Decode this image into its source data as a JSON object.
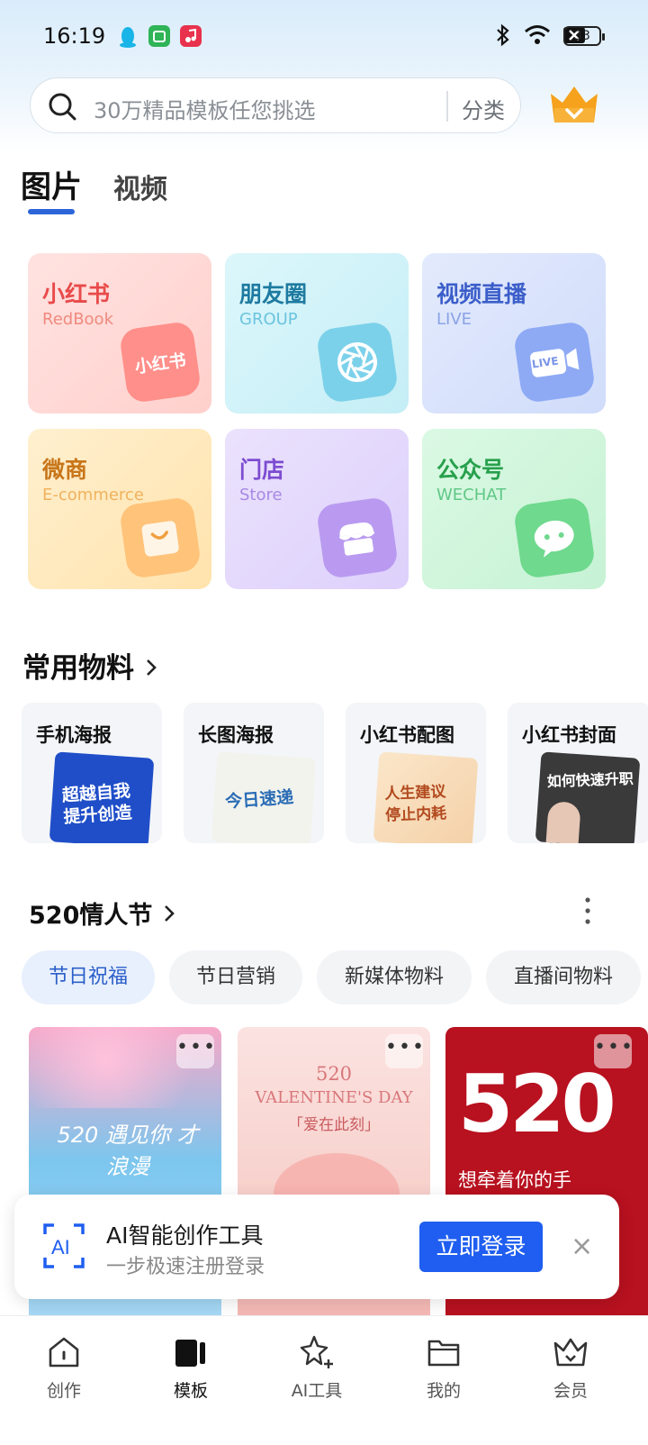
{
  "status_bar": {
    "time": "16:19",
    "battery": "33"
  },
  "search": {
    "placeholder": "30万精品模板任您挑选",
    "category_label": "分类"
  },
  "tabs": [
    {
      "label": "图片",
      "active": true
    },
    {
      "label": "视频",
      "active": false
    }
  ],
  "categories": [
    {
      "title": "小红书",
      "subtitle": "RedBook",
      "icon": "redbook-icon",
      "icon_text": "小红书",
      "color": "#e84a4a",
      "sub_color": "#f08a7e"
    },
    {
      "title": "朋友圈",
      "subtitle": "GROUP",
      "icon": "aperture-icon",
      "color": "#1e7aa0",
      "sub_color": "#6cc4df"
    },
    {
      "title": "视频直播",
      "subtitle": "LIVE",
      "icon": "live-camera-icon",
      "icon_text": "LIVE",
      "color": "#3b5ec9",
      "sub_color": "#8aa3e6"
    },
    {
      "title": "微商",
      "subtitle": "E-commerce",
      "icon": "shopping-bag-icon",
      "color": "#c8761a",
      "sub_color": "#f0b25c"
    },
    {
      "title": "门店",
      "subtitle": "Store",
      "icon": "store-icon",
      "color": "#7c4cd1",
      "sub_color": "#a889e4"
    },
    {
      "title": "公众号",
      "subtitle": "WECHAT",
      "icon": "wechat-icon",
      "color": "#27a04c",
      "sub_color": "#5fc886"
    }
  ],
  "common_materials": {
    "title": "常用物料",
    "items": [
      {
        "label": "手机海报",
        "thumb_text": "超越自我 提升创造"
      },
      {
        "label": "长图海报",
        "thumb_text": "今日速递"
      },
      {
        "label": "小红书配图",
        "thumb_text": "人生建议 停止内耗"
      },
      {
        "label": "小红书封面",
        "thumb_text": "如何快速升职"
      }
    ]
  },
  "holiday_section": {
    "title": "520情人节",
    "chips": [
      {
        "label": "节日祝福",
        "active": true
      },
      {
        "label": "节日营销",
        "active": false
      },
      {
        "label": "新媒体物料",
        "active": false
      },
      {
        "label": "直播间物料",
        "active": false
      }
    ],
    "templates": [
      {
        "text": "520 遇见你 才浪漫"
      },
      {
        "text": "VALENTINE'S DAY",
        "sub": "「爱在此刻」"
      },
      {
        "text": "520",
        "sub": "想牵着你的手"
      }
    ],
    "more_label": "•••"
  },
  "login_banner": {
    "title": "AI智能创作工具",
    "subtitle": "一步极速注册登录",
    "button": "立即登录",
    "close": "×"
  },
  "bottom_nav": [
    {
      "label": "创作",
      "icon": "home-icon",
      "active": false
    },
    {
      "label": "模板",
      "icon": "template-icon",
      "active": true
    },
    {
      "label": "AI工具",
      "icon": "ai-sparkle-icon",
      "active": false
    },
    {
      "label": "我的",
      "icon": "folder-icon",
      "active": false
    },
    {
      "label": "会员",
      "icon": "crown-icon",
      "active": false
    }
  ]
}
